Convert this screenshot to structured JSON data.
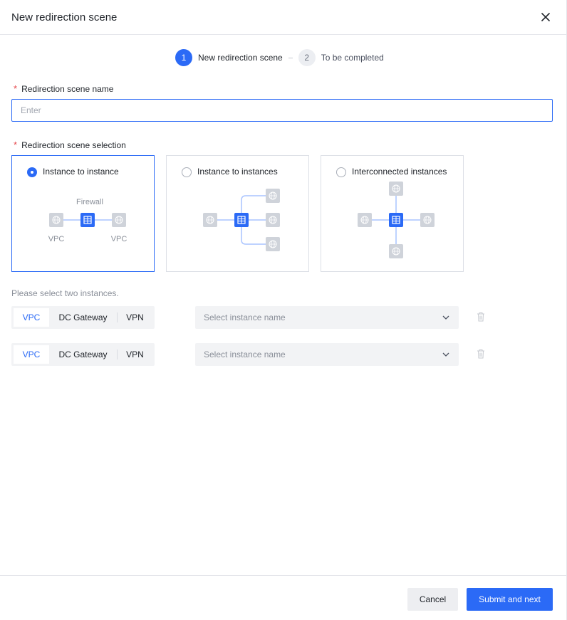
{
  "dialog": {
    "title": "New redirection scene"
  },
  "steps": [
    {
      "number": "1",
      "label": "New redirection scene"
    },
    {
      "number": "2",
      "label": "To be completed"
    }
  ],
  "name_field": {
    "label": "Redirection scene name",
    "placeholder": "Enter",
    "value": ""
  },
  "scene_field": {
    "label": "Redirection scene selection",
    "options": [
      {
        "label": "Instance to instance",
        "selected": true,
        "firewall_label": "Firewall",
        "left_label": "VPC",
        "right_label": "VPC"
      },
      {
        "label": "Instance to instances",
        "selected": false
      },
      {
        "label": "Interconnected instances",
        "selected": false
      }
    ]
  },
  "instances": {
    "hint": "Please select two instances.",
    "rows": [
      {
        "types": [
          "VPC",
          "DC Gateway",
          "VPN"
        ],
        "active_type": "VPC",
        "select_placeholder": "Select instance name"
      },
      {
        "types": [
          "VPC",
          "DC Gateway",
          "VPN"
        ],
        "active_type": "VPC",
        "select_placeholder": "Select instance name"
      }
    ]
  },
  "footer": {
    "cancel_label": "Cancel",
    "submit_label": "Submit and next"
  },
  "colors": {
    "primary": "#2b6af6",
    "border": "#e5e6eb",
    "muted": "#8a8f99",
    "required": "#e5484d"
  },
  "icons": {
    "close": "close-icon",
    "globe": "globe-icon",
    "firewall": "firewall-icon",
    "chevron": "chevron-down-icon",
    "trash": "trash-icon"
  }
}
